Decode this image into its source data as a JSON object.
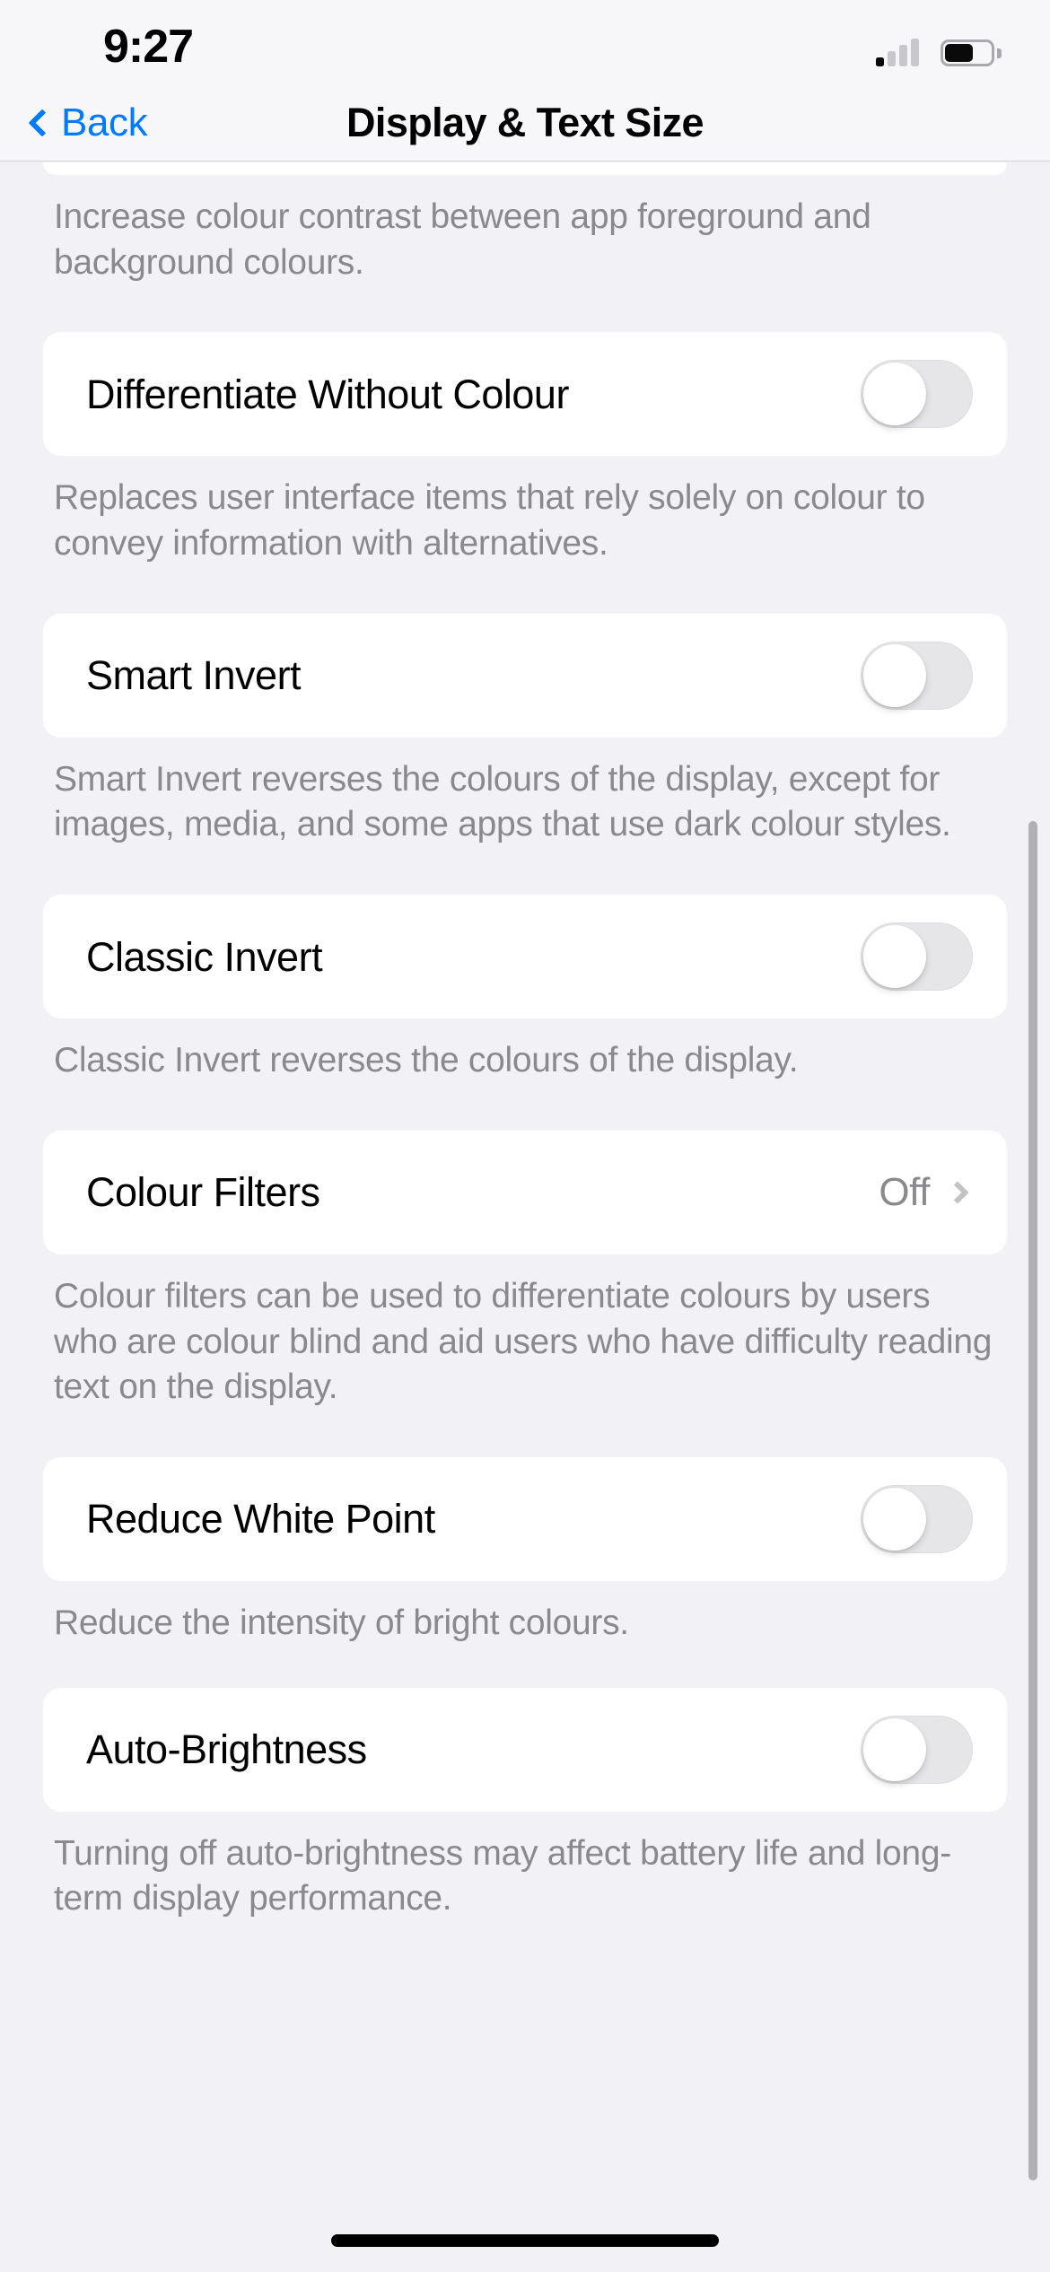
{
  "status_bar": {
    "time": "9:27",
    "signal_icon": "cellular-signal-icon",
    "signal_bars_filled": 1,
    "signal_bars_total": 4,
    "battery_icon": "battery-icon",
    "battery_level_percent": 60
  },
  "nav": {
    "back_label": "Back",
    "back_icon": "chevron-left-icon",
    "title": "Display & Text Size"
  },
  "colors": {
    "accent": "#007AFF",
    "background": "#F2F1F6",
    "card": "#FFFFFF",
    "secondary_text": "#8A8A8E",
    "toggle_off_track": "#E6E6E9"
  },
  "sections": [
    {
      "key": "increase_contrast",
      "clipped": true,
      "footer": "Increase colour contrast between app foreground and background colours."
    },
    {
      "key": "differentiate_without_colour",
      "label": "Differentiate Without Colour",
      "control": "toggle",
      "value": "off",
      "footer": "Replaces user interface items that rely solely on colour to convey information with alternatives."
    },
    {
      "key": "smart_invert",
      "label": "Smart Invert",
      "control": "toggle",
      "value": "off",
      "footer": "Smart Invert reverses the colours of the display, except for images, media, and some apps that use dark colour styles."
    },
    {
      "key": "classic_invert",
      "label": "Classic Invert",
      "control": "toggle",
      "value": "off",
      "footer": "Classic Invert reverses the colours of the display."
    },
    {
      "key": "colour_filters",
      "label": "Colour Filters",
      "control": "disclosure",
      "value": "Off",
      "footer": "Colour filters can be used to differentiate colours by users who are colour blind and aid users who have difficulty reading text on the display."
    },
    {
      "key": "reduce_white_point",
      "label": "Reduce White Point",
      "control": "toggle",
      "value": "off",
      "footer": "Reduce the intensity of bright colours."
    },
    {
      "key": "auto_brightness",
      "label": "Auto-Brightness",
      "control": "toggle",
      "value": "off",
      "footer": "Turning off auto-brightness may affect battery life and long-term display performance."
    }
  ],
  "home_indicator": "home-indicator"
}
